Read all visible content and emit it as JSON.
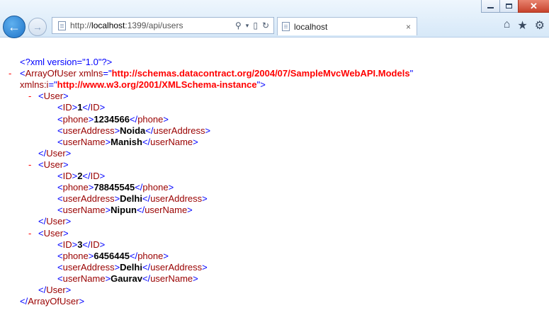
{
  "window": {
    "buttons": [
      "minimize",
      "maximize",
      "close"
    ]
  },
  "nav": {
    "back_icon": "back-arrow-icon",
    "forward_icon": "forward-arrow-icon"
  },
  "address_bar": {
    "prefix": "http://",
    "host": "localhost",
    "rest": ":1399/api/users",
    "icons": [
      "search-icon",
      "dropdown-icon",
      "compat-icon",
      "refresh-icon"
    ]
  },
  "tab": {
    "title": "localhost",
    "close": "×"
  },
  "toolbar_icons": [
    "home-icon",
    "favorites-icon",
    "tools-icon"
  ],
  "xml": {
    "declaration": "<?xml version=\"1.0\"?>",
    "root_open_prefix": "<ArrayOfUser xmlns=\"",
    "root_ns1": "http://schemas.datacontract.org/2004/07/SampleMvcWebAPI.Models",
    "root_mid": "\" xmlns:i=\"",
    "root_ns2": "http://www.w3.org/2001/XMLSchema-instance",
    "root_close_suffix": "\">",
    "root_end": "</ArrayOfUser>",
    "minus": "-",
    "users": [
      {
        "ID": "1",
        "phone": "1234566",
        "userAddress": "Noida",
        "userName": "Manish"
      },
      {
        "ID": "2",
        "phone": "78845545",
        "userAddress": "Delhi",
        "userName": "Nipun"
      },
      {
        "ID": "3",
        "phone": "6456445",
        "userAddress": "Delhi",
        "userName": "Gaurav"
      }
    ]
  }
}
